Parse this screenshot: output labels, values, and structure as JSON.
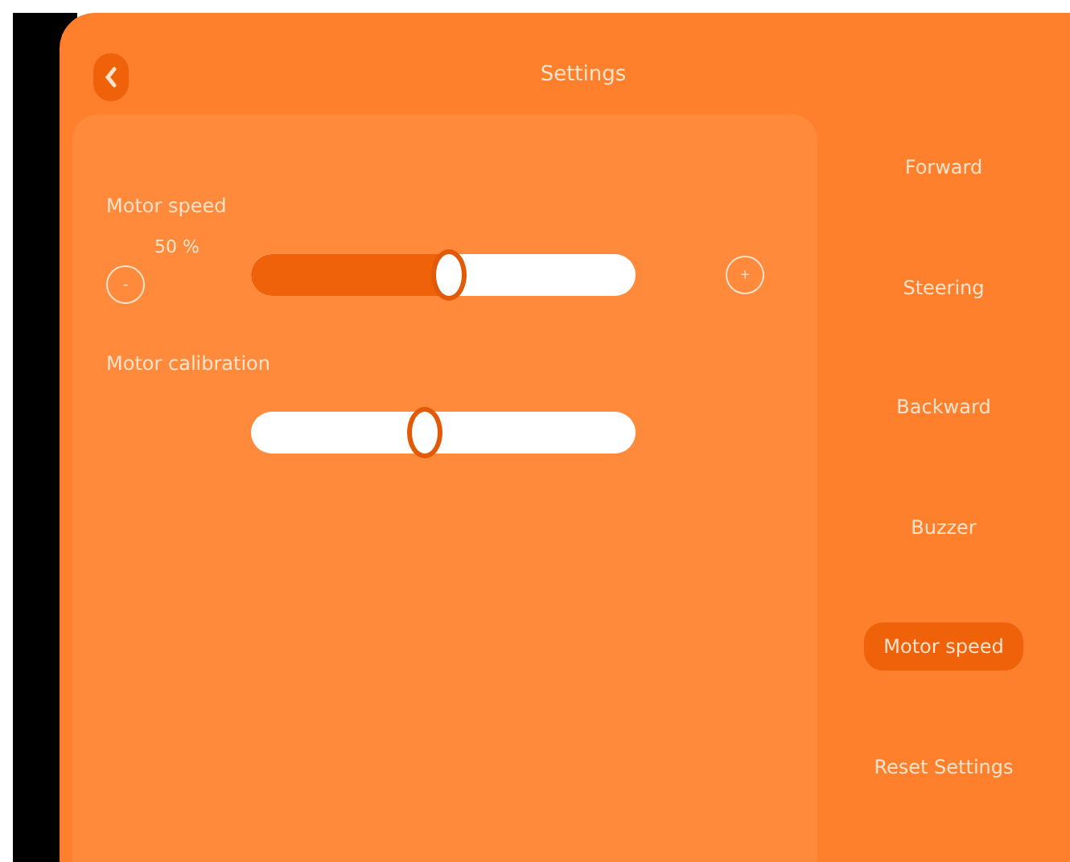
{
  "header": {
    "title": "Settings"
  },
  "sliders": [
    {
      "label": "Motor speed",
      "reading": "50 %",
      "kind": "fill",
      "level": 0.5,
      "minus": "-",
      "plus": "+"
    },
    {
      "label": "Motor calibration",
      "kind": "plain",
      "level": 0.44
    }
  ],
  "menu": [
    {
      "label": "Forward",
      "selected": false
    },
    {
      "label": "Steering",
      "selected": false
    },
    {
      "label": "Backward",
      "selected": false
    },
    {
      "label": "Buzzer",
      "selected": false
    },
    {
      "label": "Motor speed",
      "selected": true
    },
    {
      "label": "Reset Settings",
      "selected": false
    }
  ]
}
